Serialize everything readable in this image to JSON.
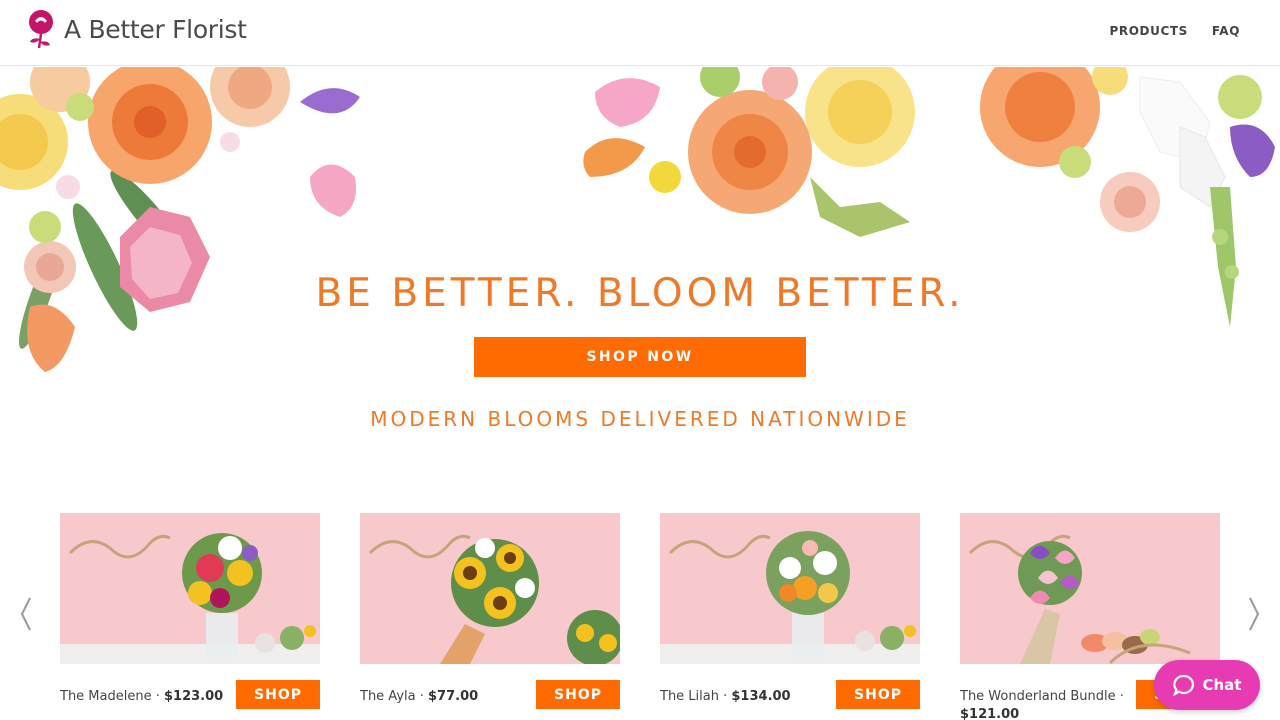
{
  "header": {
    "logo_text": "A Better Florist",
    "nav": [
      {
        "label": "PRODUCTS"
      },
      {
        "label": "FAQ"
      }
    ]
  },
  "hero": {
    "tagline": "BE BETTER. BLOOM BETTER.",
    "cta_label": "SHOP NOW",
    "subtitle": "MODERN BLOOMS DELIVERED NATIONWIDE"
  },
  "products": [
    {
      "name": "The Madelene",
      "separator": " · ",
      "price": "$123.00",
      "button": "SHOP"
    },
    {
      "name": "The Ayla",
      "separator": " · ",
      "price": "$77.00",
      "button": "SHOP"
    },
    {
      "name": "The Lilah",
      "separator": " · ",
      "price": "$134.00",
      "button": "SHOP"
    },
    {
      "name": "The Wonderland Bundle",
      "separator": " · ",
      "price": "$121.00",
      "button": "SHOP"
    }
  ],
  "chat": {
    "label": "Chat",
    "icon": "chat-bubble-icon"
  },
  "carousel": {
    "prev_icon": "chevron-left-icon",
    "next_icon": "chevron-right-icon"
  },
  "colors": {
    "accent": "#ff6b00",
    "heading": "#ee7a28",
    "chat": "#e63bb3",
    "logo": "#c4146a",
    "product_bg": "#f7c9cc"
  }
}
